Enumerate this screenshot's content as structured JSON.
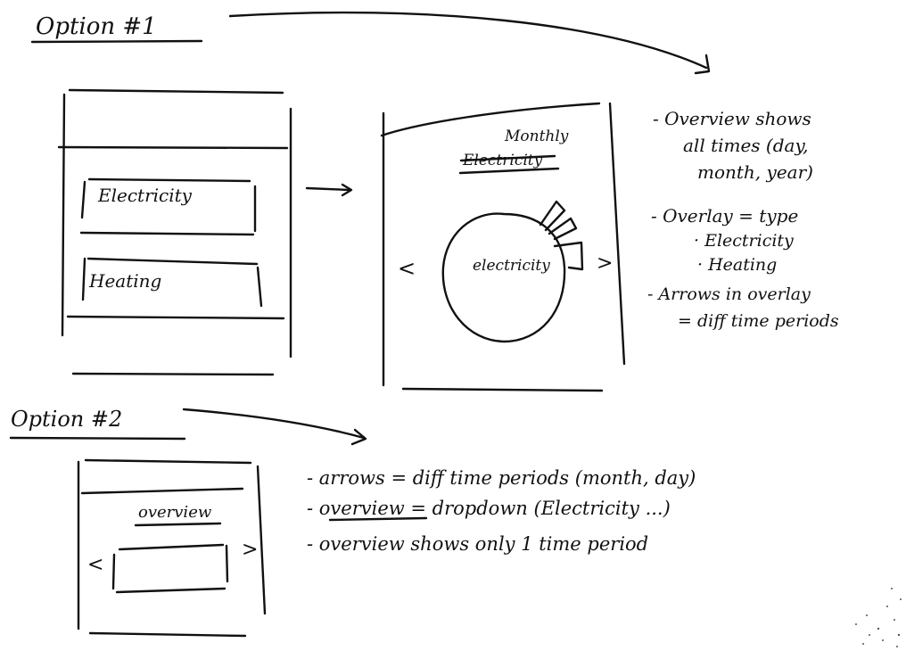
{
  "option1": {
    "heading": "Option #1",
    "left_wireframe": {
      "buttons": [
        "Electricity",
        "Heating"
      ]
    },
    "right_wireframe": {
      "title": "Monthly",
      "struck_title": "Electricity",
      "pie_label": "electricity",
      "arrow_left": "<",
      "arrow_right": ">"
    },
    "notes": [
      "- Overview shows",
      "all times (day,",
      "month, year)",
      "- Overlay = type",
      "· Electricity",
      "· Heating",
      "- Arrows in overlay",
      "= diff time periods"
    ]
  },
  "option2": {
    "heading": "Option #2",
    "wireframe": {
      "title": "overview",
      "arrow_left": "<",
      "arrow_right": ">"
    },
    "notes": [
      "- arrows = diff time periods (month, day)",
      "- overview = dropdown (Electricity ...)",
      "- overview shows only 1 time period"
    ]
  }
}
